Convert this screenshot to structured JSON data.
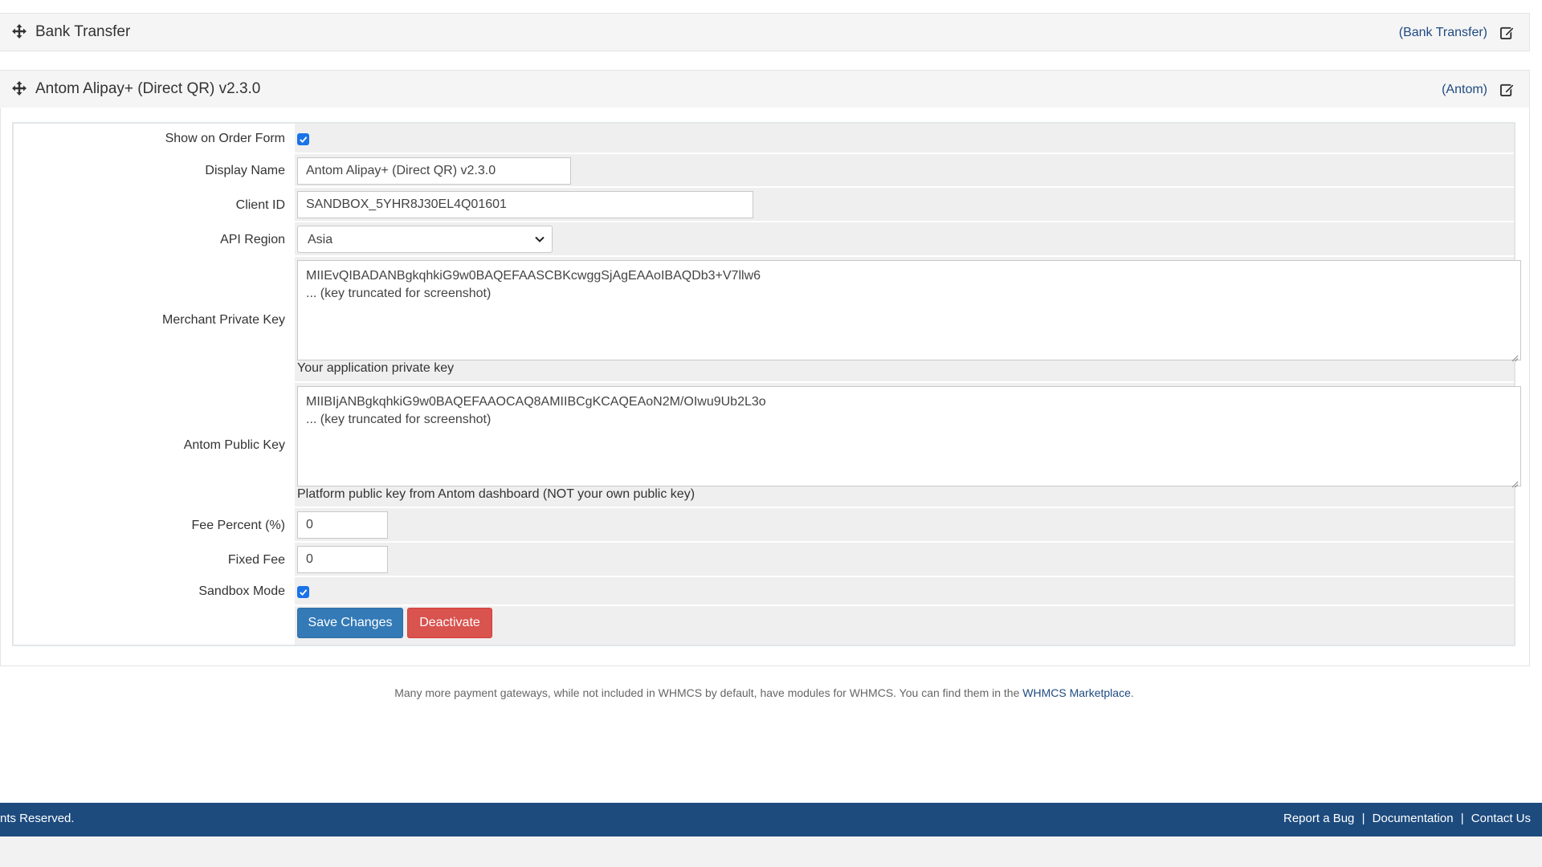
{
  "panels": [
    {
      "title": "Bank Transfer",
      "link": "(Bank Transfer)"
    },
    {
      "title": "Antom Alipay+ (Direct QR) v2.3.0",
      "link": "(Antom)"
    }
  ],
  "form": {
    "show_on_order_form": {
      "label": "Show on Order Form",
      "checked": true
    },
    "display_name": {
      "label": "Display Name",
      "value": "Antom Alipay+ (Direct QR) v2.3.0"
    },
    "client_id": {
      "label": "Client ID",
      "value": "SANDBOX_5YHR8J30EL4Q01601"
    },
    "api_region": {
      "label": "API Region",
      "value": "Asia"
    },
    "merchant_private_key": {
      "label": "Merchant Private Key",
      "value": "MIIEvQIBADANBgkqhkiG9w0BAQEFAASCBKcwggSjAgEAAoIBAQDb3+V7llw6\n... (key truncated for screenshot)",
      "help": "Your application private key"
    },
    "antom_public_key": {
      "label": "Antom Public Key",
      "value": "MIIBIjANBgkqhkiG9w0BAQEFAAOCAQ8AMIIBCgKCAQEAoN2M/OIwu9Ub2L3o\n... (key truncated for screenshot)",
      "help": "Platform public key from Antom dashboard (NOT your own public key)"
    },
    "fee_percent": {
      "label": "Fee Percent (%)",
      "value": "0"
    },
    "fixed_fee": {
      "label": "Fixed Fee",
      "value": "0"
    },
    "sandbox_mode": {
      "label": "Sandbox Mode",
      "checked": true
    },
    "save_label": "Save Changes",
    "deactivate_label": "Deactivate"
  },
  "note": {
    "text": "Many more payment gateways, while not included in WHMCS by default, have modules for WHMCS. You can find them in the ",
    "link": "WHMCS Marketplace",
    "end": "."
  },
  "footer": {
    "copyright": "nts Reserved.",
    "links": [
      "Report a Bug",
      "Documentation",
      "Contact Us"
    ],
    "separator": "|"
  },
  "colors": {
    "accent": "#337ab7",
    "danger": "#d9534f",
    "footer": "#1d4b7e",
    "link": "#1f4a82",
    "checkbox": "#1a73e8"
  }
}
